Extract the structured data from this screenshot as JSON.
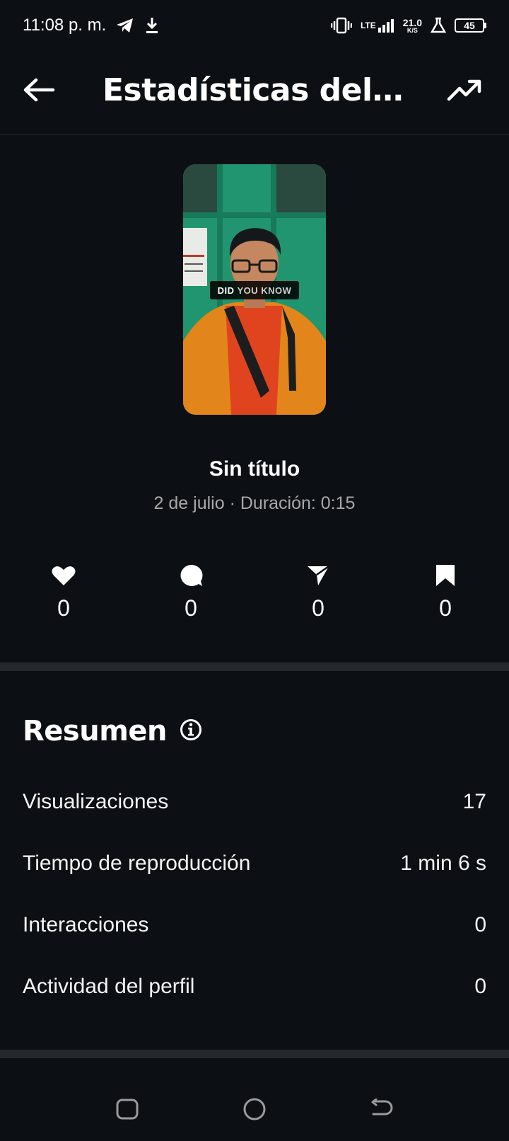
{
  "status_bar": {
    "time": "11:08 p. m.",
    "lte_label": "LTE",
    "net_speed_value": "21.0",
    "net_speed_unit": "K/S",
    "battery": "45"
  },
  "header": {
    "title": "Estadísticas del re...",
    "back_icon": "arrow-left-icon",
    "trend_icon": "trending-up-icon"
  },
  "thumbnail": {
    "caption_word1": "DID",
    "caption_word2": "YOU KNOW"
  },
  "reel": {
    "title": "Sin título",
    "meta": "2 de julio · Duración: 0:15"
  },
  "engagement": [
    {
      "icon": "heart-icon",
      "count": "0"
    },
    {
      "icon": "comment-icon",
      "count": "0"
    },
    {
      "icon": "share-icon",
      "count": "0"
    },
    {
      "icon": "bookmark-icon",
      "count": "0"
    }
  ],
  "summary": {
    "title": "Resumen",
    "rows": [
      {
        "label": "Visualizaciones",
        "value": "17"
      },
      {
        "label": "Tiempo de reproducción",
        "value": "1 min 6 s"
      },
      {
        "label": "Interacciones",
        "value": "0"
      },
      {
        "label": "Actividad del perfil",
        "value": "0"
      }
    ]
  },
  "navbar": {
    "icons": [
      "recents-icon",
      "home-icon",
      "back-icon"
    ]
  },
  "colors": {
    "background": "#0c1014",
    "text_primary": "#f5f5f5",
    "text_secondary": "#a8a8a8",
    "divider": "#25292e"
  }
}
